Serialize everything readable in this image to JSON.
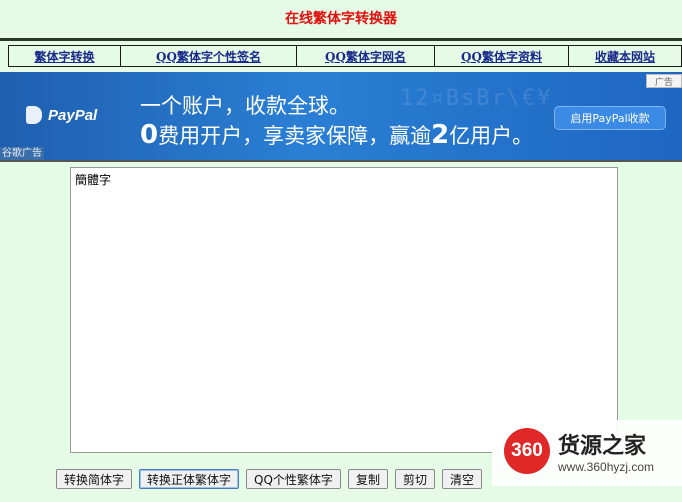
{
  "page": {
    "title": "在线繁体字转换器"
  },
  "nav": {
    "items": [
      {
        "label": "繁体字转换"
      },
      {
        "label": "QQ繁体字个性签名"
      },
      {
        "label": "QQ繁体字网名"
      },
      {
        "label": "QQ繁体字资料"
      },
      {
        "label": "收藏本网站"
      }
    ]
  },
  "ad": {
    "brand": "PayPal",
    "line1": "一个账户，收款全球。",
    "line2_prefix": "0",
    "line2_mid": "费用开户，享卖家保障，赢逾",
    "line2_num": "2",
    "line2_suffix": "亿用户。",
    "cta": "启用PayPal收款",
    "tag": "广告",
    "credit": "谷歌广告",
    "watermark": "12¤BsBr\\€¥"
  },
  "editor": {
    "value": "簡體字"
  },
  "buttons": {
    "to_simplified": "转换简体字",
    "to_traditional": "转换正体繁体字",
    "qq_traditional": "QQ个性繁体字",
    "copy": "复制",
    "cut": "剪切",
    "clear": "清空"
  },
  "site_watermark": {
    "logo": "360",
    "name": "货源之家",
    "url": "www.360hyzj.com"
  }
}
